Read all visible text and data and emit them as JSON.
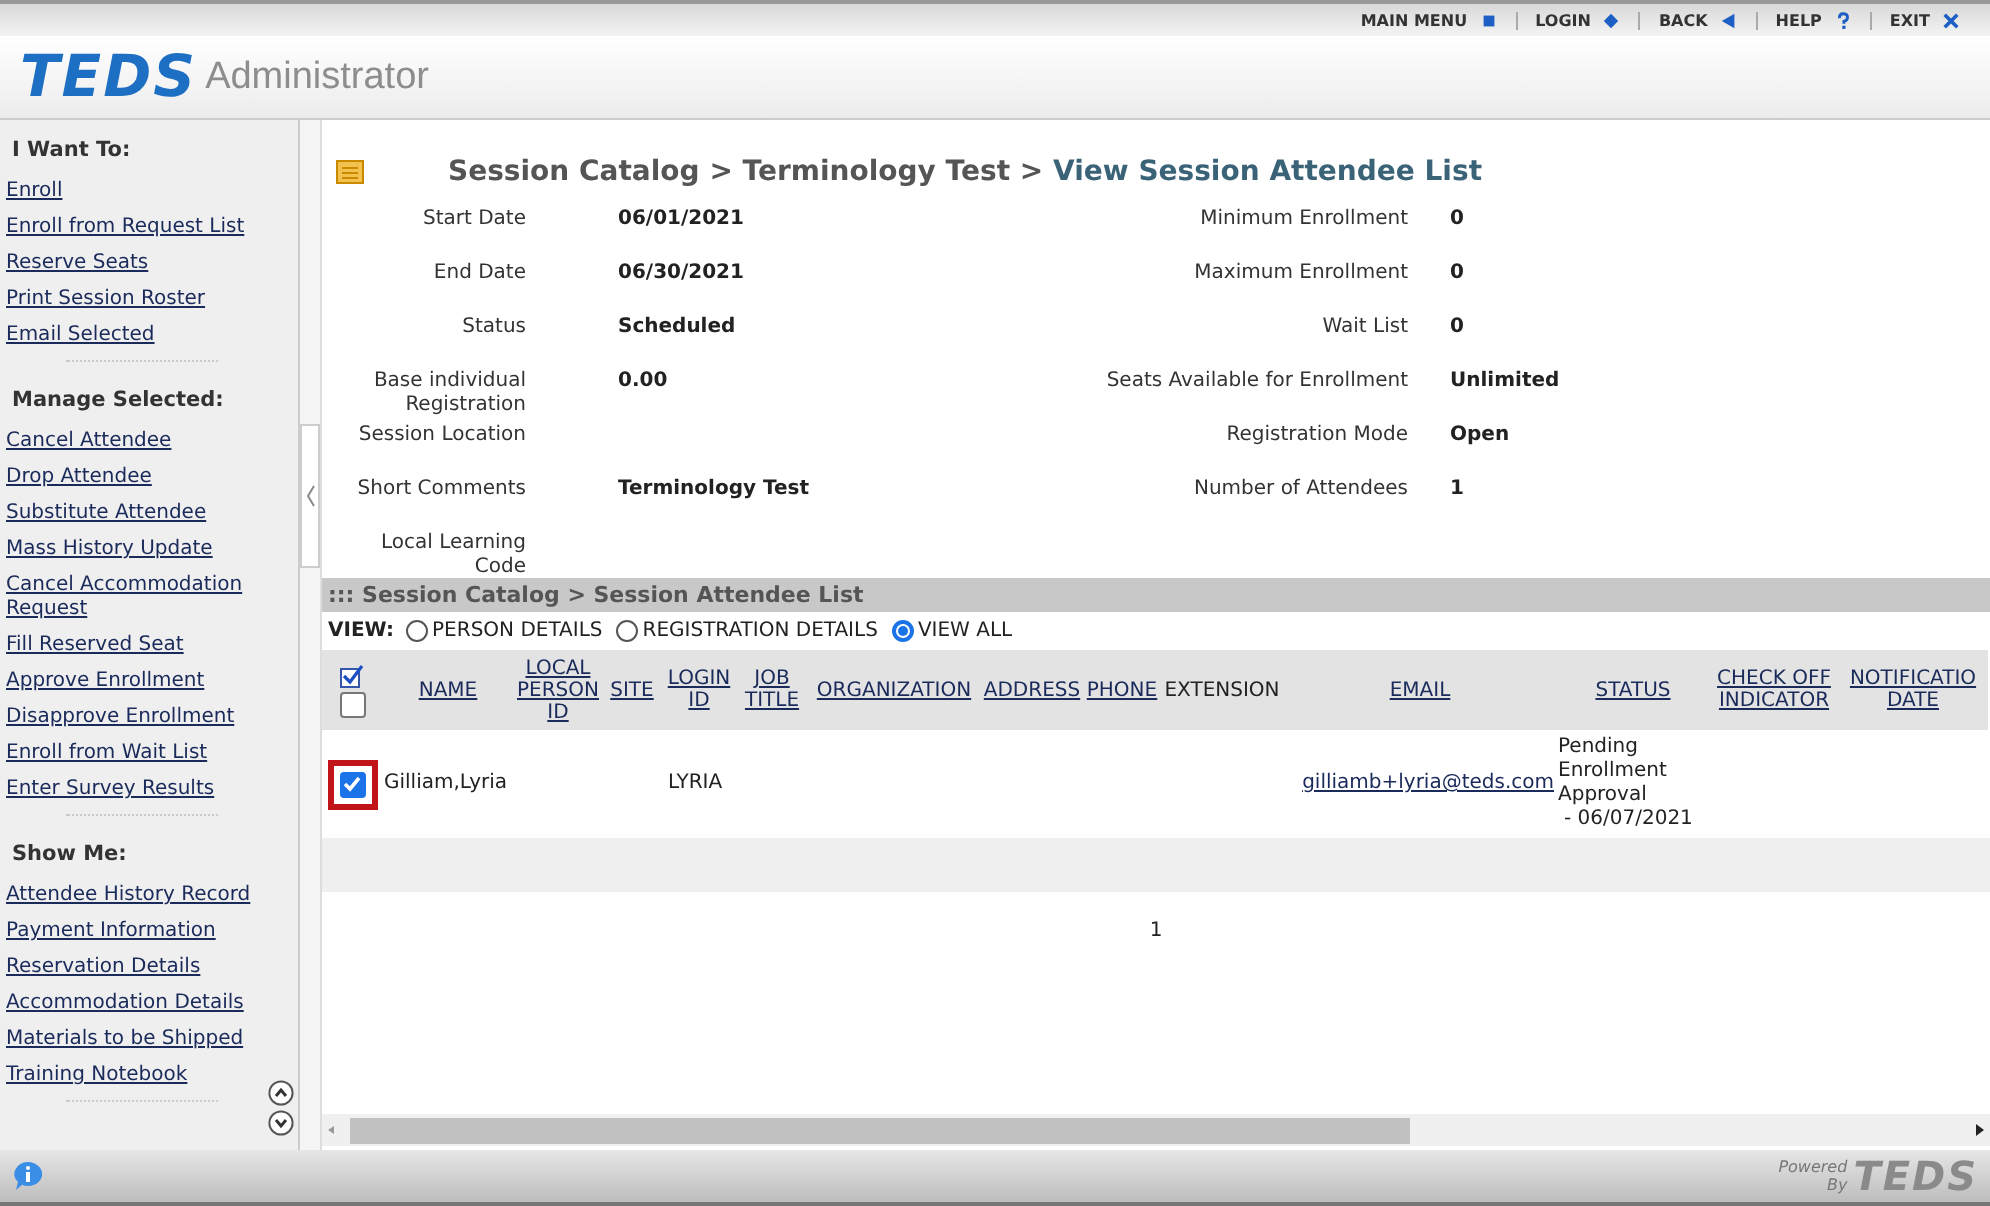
{
  "top_nav": [
    {
      "label": "MAIN MENU",
      "kind": "square"
    },
    {
      "label": "LOGIN",
      "kind": "diamond"
    },
    {
      "label": "BACK",
      "kind": "back"
    },
    {
      "label": "HELP",
      "kind": "help"
    },
    {
      "label": "EXIT",
      "kind": "close"
    }
  ],
  "header": {
    "logo": "TEDS",
    "title": "Administrator"
  },
  "sidebar": {
    "sections": [
      {
        "heading": "I Want To:",
        "links": [
          "Enroll",
          "Enroll from Request List",
          "Reserve Seats",
          "Print Session Roster",
          "Email Selected"
        ]
      },
      {
        "heading": "Manage Selected:",
        "links": [
          "Cancel Attendee",
          "Drop Attendee",
          "Substitute Attendee",
          "Mass History Update",
          "Cancel Accommodation Request",
          "Fill Reserved Seat",
          "Approve Enrollment",
          "Disapprove Enrollment",
          "Enroll from Wait List",
          "Enter Survey Results"
        ]
      },
      {
        "heading": "Show Me:",
        "links": [
          "Attendee History Record",
          "Payment Information",
          "Reservation Details",
          "Accommodation Details",
          "Materials to be Shipped",
          "Training Notebook"
        ]
      }
    ]
  },
  "breadcrumb_separator": ">",
  "breadcrumb": [
    {
      "label": "Session Catalog",
      "current": false
    },
    {
      "label": "Terminology Test",
      "current": false
    },
    {
      "label": "View Session Attendee List",
      "current": true
    }
  ],
  "details": [
    {
      "label": "Start Date",
      "value": "06/01/2021",
      "label2": "Minimum Enrollment",
      "value2": "0"
    },
    {
      "label": "End Date",
      "value": "06/30/2021",
      "label2": "Maximum Enrollment",
      "value2": "0"
    },
    {
      "label": "Status",
      "value": "Scheduled",
      "label2": "Wait List",
      "value2": "0"
    },
    {
      "label": "Base individual Registration",
      "value": "0.00",
      "label2": "Seats Available for Enrollment",
      "value2": "Unlimited"
    },
    {
      "label": "Session Location",
      "label2": "Registration Mode",
      "value2": "Open"
    },
    {
      "label": "Short Comments",
      "value": "Terminology Test",
      "label2": "Number of Attendees",
      "value2": "1"
    },
    {
      "label": "Local Learning Code"
    }
  ],
  "section_title": "::: Session Catalog > Session Attendee List",
  "view": {
    "label": "VIEW:",
    "options": [
      {
        "label": "PERSON DETAILS",
        "selected": false
      },
      {
        "label": "REGISTRATION DETAILS",
        "selected": false
      },
      {
        "label": "VIEW ALL",
        "selected": true
      }
    ]
  },
  "table": {
    "header_checkbox": {
      "checked": false
    },
    "columns": [
      {
        "label": "NAME",
        "link": true
      },
      {
        "label": "LOCAL PERSON ID",
        "link": true
      },
      {
        "label": "SITE",
        "link": true
      },
      {
        "label": "LOGIN ID",
        "link": true
      },
      {
        "label": "JOB TITLE",
        "link": true
      },
      {
        "label": "ORGANIZATION",
        "link": true
      },
      {
        "label": "ADDRESS",
        "link": true
      },
      {
        "label": "PHONE",
        "link": true
      },
      {
        "label": "EXTENSION",
        "link": false
      },
      {
        "label": "EMAIL",
        "link": true
      },
      {
        "label": "STATUS",
        "link": true
      },
      {
        "label": "CHECK OFF INDICATOR",
        "link": true
      },
      {
        "label": "NOTIFICATIO DATE",
        "link": true
      }
    ],
    "rows": [
      {
        "checked": true,
        "highlighted": true,
        "name": "Gilliam,Lyria",
        "login_id": "LYRIA",
        "email": "gilliamb+lyria@teds.com",
        "status": "Pending Enrollment Approval",
        "status_date": "- 06/07/2021"
      }
    ]
  },
  "pagination": [
    "1"
  ],
  "footer": {
    "powered": "Powered",
    "by": "By",
    "logo": "TEDS"
  }
}
